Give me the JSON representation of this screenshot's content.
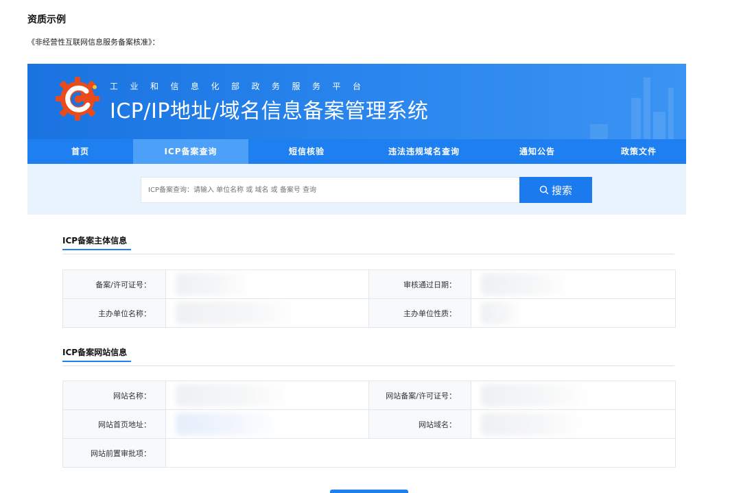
{
  "doc": {
    "title": "资质示例",
    "subtitle": "《非经营性互联网信息服务备案核准》："
  },
  "banner": {
    "small_title": "工业和信息化部政务服务平台",
    "big_title": "ICP/IP地址/域名信息备案管理系统",
    "logo_icon": "miit-gear-logo-icon"
  },
  "nav": {
    "items": [
      {
        "label": "首页"
      },
      {
        "label": "ICP备案查询",
        "active": true
      },
      {
        "label": "短信核验"
      },
      {
        "label": "违法违规域名查询"
      },
      {
        "label": "通知公告"
      },
      {
        "label": "政策文件"
      }
    ]
  },
  "search": {
    "placeholder": "ICP备案查询：请输入 单位名称 或 域名 或 备案号 查询",
    "button_label": "搜索",
    "button_icon": "search-icon"
  },
  "subject": {
    "heading": "ICP备案主体信息",
    "rows": [
      {
        "label1": "备案/许可证号：",
        "label2": "审核通过日期："
      },
      {
        "label1": "主办单位名称：",
        "label2": "主办单位性质："
      }
    ]
  },
  "website": {
    "heading": "ICP备案网站信息",
    "rows": [
      {
        "label1": "网站名称：",
        "label2": "网站备案/许可证号："
      },
      {
        "label1": "网站首页地址：",
        "label2": "网站域名："
      },
      {
        "label1": "网站前置审批项："
      }
    ]
  },
  "colors": {
    "brand_blue": "#1e80f0",
    "active_tab": "#4da0f7",
    "search_band": "#e9f3fd"
  }
}
